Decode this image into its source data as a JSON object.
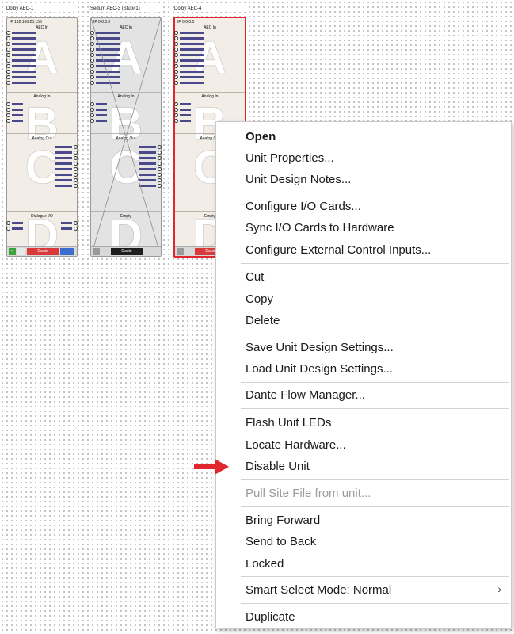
{
  "units": [
    {
      "title": "Dolby AEC-1",
      "ip": "IP 192.168.20.153",
      "sections": {
        "a_head": "AEC In",
        "b_head": "Analog In",
        "c_head": "Analog Out",
        "d_head": "Dialogue I/O"
      },
      "letters": [
        "A",
        "B",
        "C",
        "D"
      ],
      "footer_label": "Dante"
    },
    {
      "title": "Sedum AEC-3 (Stub#1)",
      "ip": "IP 0.0.0.0",
      "sections": {
        "a_head": "AEC In",
        "b_head": "Analog In",
        "c_head": "Analog Out",
        "d_head": "Empty"
      },
      "letters": [
        "A",
        "B",
        "C",
        "D"
      ],
      "footer_label": "Dante"
    },
    {
      "title": "Dolby AEC-4",
      "ip": "IP 0.0.0.0",
      "sections": {
        "a_head": "AEC In",
        "b_head": "Analog In",
        "c_head": "Analog Out",
        "d_head": "Empty"
      },
      "letters": [
        "A",
        "B",
        "C",
        "D"
      ],
      "footer_label": "Dante"
    }
  ],
  "menu": {
    "items": {
      "open": "Open",
      "unit_properties": "Unit Properties...",
      "unit_design_notes": "Unit Design Notes...",
      "configure_io_cards": "Configure I/O Cards...",
      "sync_io_cards": "Sync I/O Cards to Hardware",
      "configure_external": "Configure External Control Inputs...",
      "cut": "Cut",
      "copy": "Copy",
      "delete": "Delete",
      "save_settings": "Save Unit Design Settings...",
      "load_settings": "Load Unit Design Settings...",
      "dante_flow": "Dante Flow Manager...",
      "flash_leds": "Flash Unit LEDs",
      "locate_hardware": "Locate Hardware...",
      "disable_unit": "Disable Unit",
      "pull_site_file": "Pull Site File from unit...",
      "bring_forward": "Bring Forward",
      "send_to_back": "Send to Back",
      "locked": "Locked",
      "smart_select": "Smart Select Mode: Normal",
      "duplicate": "Duplicate"
    },
    "submenu_glyph": "›"
  },
  "colors": {
    "selection": "#e1262d",
    "annotation_arrow": "#e1262d",
    "footer_green": "#3aa33a",
    "footer_red": "#d83a3a",
    "dante_blue": "#3a6fd0"
  }
}
